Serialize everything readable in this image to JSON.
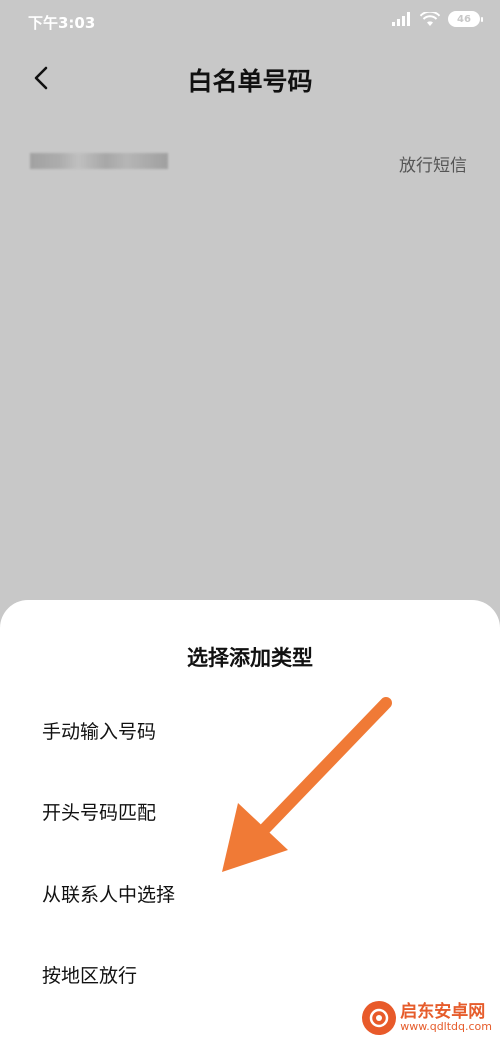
{
  "status_bar": {
    "time": "下午3:03",
    "battery": "46"
  },
  "header": {
    "title": "白名单号码"
  },
  "list": {
    "row_action": "放行短信"
  },
  "sheet": {
    "title": "选择添加类型",
    "options": [
      "手动输入号码",
      "开头号码匹配",
      "从联系人中选择",
      "按地区放行"
    ]
  },
  "watermark": {
    "name": "启东安卓网",
    "url": "www.qdltdq.com"
  },
  "colors": {
    "overlay_gray": "#c8c8c8",
    "arrow": "#f07a36",
    "watermark": "#e65c2b"
  }
}
